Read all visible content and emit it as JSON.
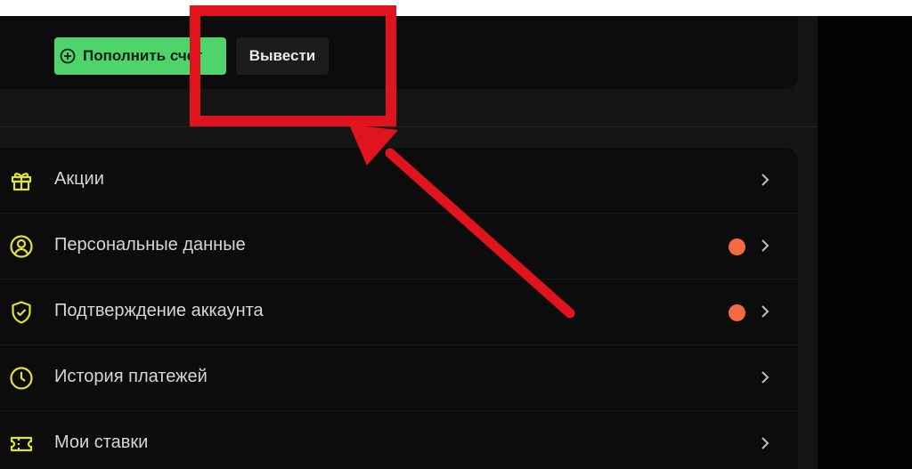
{
  "account": {
    "deposit_label": "Пополнить счет",
    "withdraw_label": "Вывести"
  },
  "menu": {
    "items": [
      {
        "label": "Акции",
        "icon": "gift-icon",
        "badge": false
      },
      {
        "label": "Персональные данные",
        "icon": "user-circle-icon",
        "badge": true
      },
      {
        "label": "Подтверждение аккаунта",
        "icon": "shield-check-icon",
        "badge": true
      },
      {
        "label": "История платежей",
        "icon": "clock-icon",
        "badge": false
      },
      {
        "label": "Мои ставки",
        "icon": "ticket-icon",
        "badge": false
      }
    ]
  },
  "colors": {
    "accent_green": "#4fd36b",
    "icon_yellow": "#dfe23a",
    "badge_orange": "#f26a3f",
    "annotation_red": "#e0141c"
  }
}
